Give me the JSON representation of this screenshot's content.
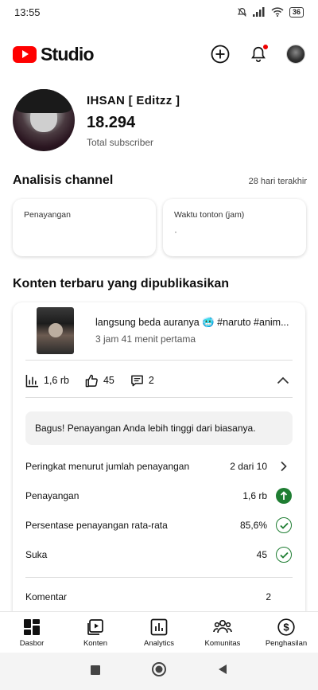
{
  "status_bar": {
    "time": "13:55",
    "battery": "36"
  },
  "header": {
    "app_name": "Studio",
    "brand_color": "#ff0000"
  },
  "channel": {
    "name": "IHSAN [ Editzz ]",
    "subscribers": "18.294",
    "subscribers_label": "Total subscriber"
  },
  "analytics": {
    "title": "Analisis channel",
    "period": "28 hari terakhir",
    "cards": [
      {
        "label": "Penayangan",
        "value": ""
      },
      {
        "label": "Waktu tonton (jam)",
        "value": "·"
      }
    ]
  },
  "latest": {
    "title": "Konten terbaru yang dipublikasikan",
    "video_title": "langsung beda auranya 🥶 #naruto #anim...",
    "video_subtitle": "3 jam 41 menit pertama",
    "views": "1,6 rb",
    "likes": "45",
    "comments": "2",
    "banner": "Bagus! Penayangan Anda lebih tinggi dari biasanya.",
    "rows": [
      {
        "label": "Peringkat menurut jumlah penayangan",
        "value": "2 dari 10",
        "trail": "chevron"
      },
      {
        "label": "Penayangan",
        "value": "1,6 rb",
        "trail": "up"
      },
      {
        "label": "Persentase penayangan rata-rata",
        "value": "85,6%",
        "trail": "check"
      },
      {
        "label": "Suka",
        "value": "45",
        "trail": "check"
      },
      {
        "label": "Komentar",
        "value": "2",
        "trail": "none"
      }
    ],
    "success_color": "#1e7d32"
  },
  "bottom_nav": [
    "Dasbor",
    "Konten",
    "Analytics",
    "Komunitas",
    "Penghasilan"
  ]
}
